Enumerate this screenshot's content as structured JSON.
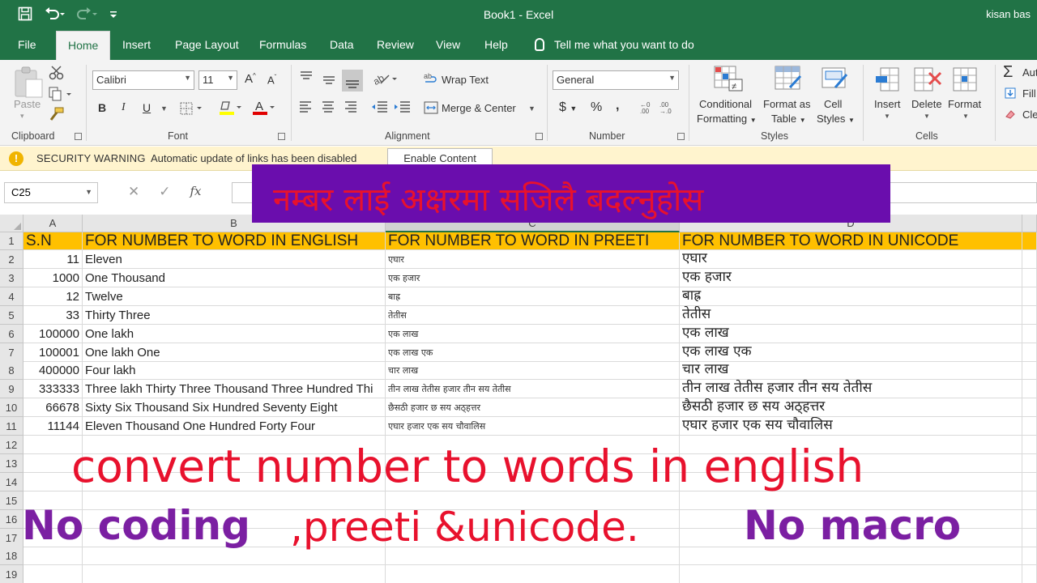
{
  "window": {
    "title": "Book1  -  Excel",
    "user": "kisan bas"
  },
  "qat": {
    "save_icon": "save-icon",
    "undo_icon": "undo-icon",
    "redo_icon": "redo-icon",
    "customize_icon": "customize-icon"
  },
  "tabs": [
    "File",
    "Home",
    "Insert",
    "Page Layout",
    "Formulas",
    "Data",
    "Review",
    "View",
    "Help"
  ],
  "tellme": "Tell me what you want to do",
  "ribbon": {
    "clipboard": {
      "paste": "Paste",
      "label": "Clipboard"
    },
    "font": {
      "name": "Calibri",
      "size": "11",
      "bold": "B",
      "italic": "I",
      "underline": "U",
      "grow": "A",
      "shrink": "A",
      "color_a": "A",
      "label": "Font"
    },
    "alignment": {
      "wrap": "Wrap Text",
      "merge": "Merge & Center",
      "label": "Alignment"
    },
    "number": {
      "format": "General",
      "currency": "$",
      "percent": "%",
      "comma": "੹",
      "label": "Number"
    },
    "styles": {
      "conditional": "Conditional",
      "formatting": "Formatting",
      "format_as": "Format as",
      "table": "Table",
      "cell": "Cell",
      "styles_btn": "Styles",
      "label": "Styles"
    },
    "cells": {
      "insert": "Insert",
      "delete": "Delete",
      "format": "Format",
      "label": "Cells"
    },
    "editing": {
      "autosum": "Aut",
      "fill": "Fill",
      "clear": "Cle"
    }
  },
  "security": {
    "title": "SECURITY WARNING",
    "message": "Automatic update of links has been disabled",
    "button": "Enable Content"
  },
  "formula_bar": {
    "name_box": "C25",
    "fx": "fx"
  },
  "banner": {
    "text": "नम्बर लाई अक्षरमा  सजिलै बदल्नुहोस"
  },
  "columns": [
    "A",
    "B",
    "C",
    "D"
  ],
  "rows": [
    "1",
    "2",
    "3",
    "4",
    "5",
    "6",
    "7",
    "8",
    "9",
    "10",
    "11",
    "12",
    "13",
    "14",
    "15",
    "16",
    "17",
    "18",
    "19"
  ],
  "headers": {
    "a": "S.N",
    "b": "FOR NUMBER TO WORD IN ENGLISH",
    "c": "FOR NUMBER TO WORD IN PREETI",
    "d": "FOR NUMBER TO WORD IN UNICODE"
  },
  "data": [
    {
      "sn": "11",
      "english": "Eleven",
      "preeti": "एघार",
      "unicode": "एघार"
    },
    {
      "sn": "1000",
      "english": "One Thousand",
      "preeti": "एक हजार",
      "unicode": "एक हजार"
    },
    {
      "sn": "12",
      "english": "Twelve",
      "preeti": "बाह्र",
      "unicode": "बाह्र"
    },
    {
      "sn": "33",
      "english": "Thirty Three",
      "preeti": "तेतीस",
      "unicode": "तेतीस"
    },
    {
      "sn": "100000",
      "english": "One lakh",
      "preeti": "एक लाख",
      "unicode": "एक लाख"
    },
    {
      "sn": "100001",
      "english": "One lakh One",
      "preeti": "एक लाख एक",
      "unicode": "एक लाख एक"
    },
    {
      "sn": "400000",
      "english": "Four lakh",
      "preeti": "चार लाख",
      "unicode": "चार लाख"
    },
    {
      "sn": "333333",
      "english": "Three lakh Thirty Three Thousand Three Hundred Thi",
      "preeti": "तीन लाख तेतीस हजार तीन सय तेतीस",
      "unicode": "तीन लाख तेतीस हजार तीन सय तेतीस"
    },
    {
      "sn": "66678",
      "english": "Sixty Six Thousand Six Hundred Seventy Eight",
      "preeti": "छैसठी हजार छ सय अठ्हत्तर",
      "unicode": "छैसठी हजार छ सय अठ्हत्तर"
    },
    {
      "sn": "11144",
      "english": "Eleven Thousand One Hundred Forty Four",
      "preeti": "एघार हजार एक सय चौवालिस",
      "unicode": "एघार हजार एक सय चौवालिस"
    }
  ],
  "overlay": {
    "line1": "convert number to words in english",
    "line2a": "No coding",
    "line2b": ",preeti &unicode.",
    "line2c": "No macro"
  },
  "colors": {
    "excel_green": "#217346",
    "header_fill": "#ffc000",
    "banner_bg": "#6a0dad",
    "red_text": "#e8112d",
    "purple_text": "#7b1fa2"
  }
}
